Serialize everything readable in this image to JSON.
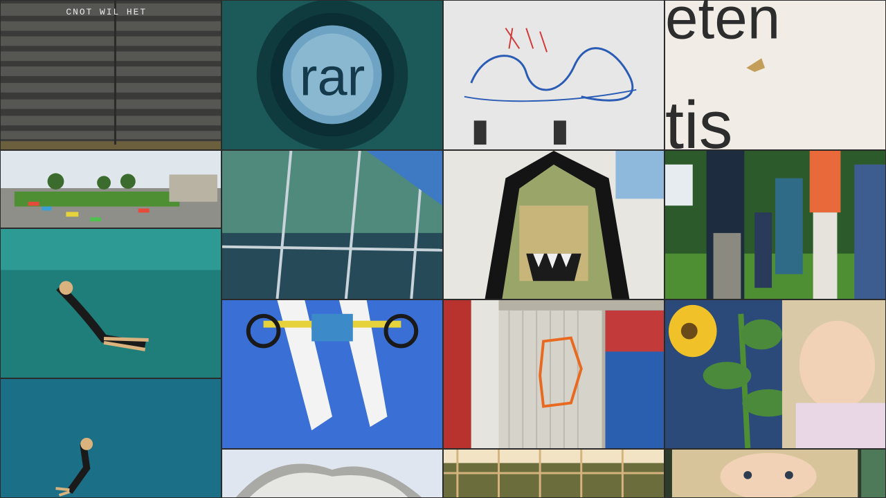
{
  "gallery": {
    "tiles": [
      {
        "id": "bench",
        "caption": "CNOT WIL HET"
      },
      {
        "id": "magnifier",
        "caption": "rar"
      },
      {
        "id": "graffiti-tag",
        "caption": ""
      },
      {
        "id": "sign-letters",
        "caption_top": "eten",
        "caption_bottom": "tis"
      },
      {
        "id": "plaza",
        "caption": ""
      },
      {
        "id": "glass-facade",
        "caption": ""
      },
      {
        "id": "hooded-skull-mural",
        "caption": ""
      },
      {
        "id": "crowd-park",
        "caption": ""
      },
      {
        "id": "swimmer-1",
        "caption": ""
      },
      {
        "id": "lego-boat",
        "caption": ""
      },
      {
        "id": "fist-graffiti-door",
        "caption": ""
      },
      {
        "id": "sunflower-girl",
        "caption": ""
      },
      {
        "id": "swimmer-2",
        "caption": ""
      },
      {
        "id": "parachute",
        "caption": ""
      },
      {
        "id": "trellis",
        "caption": ""
      },
      {
        "id": "child-closeup",
        "caption": ""
      }
    ]
  },
  "colors": {
    "water": "#1f7d7a",
    "sky": "#dfe6ec",
    "grass": "#4f8f33",
    "graffiti_blue": "#2a5bb5",
    "graffiti_orange": "#e86a20",
    "mural_green": "#9aa56a"
  }
}
